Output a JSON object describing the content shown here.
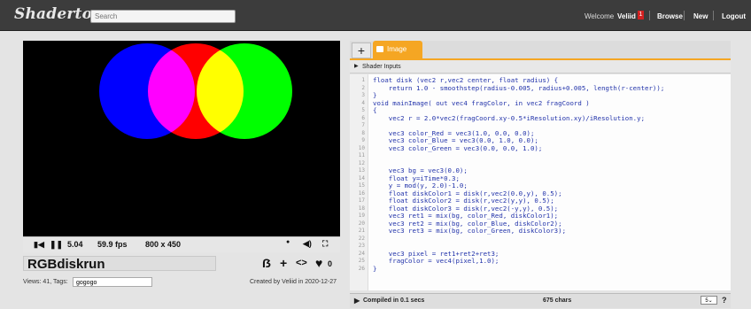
{
  "header": {
    "logo": "Shadertoy",
    "search_placeholder": "Search",
    "welcome": "Welcome",
    "user": "Veliid",
    "notification_count": "1",
    "browse": "Browse",
    "new": "New",
    "logout": "Logout"
  },
  "player": {
    "time": "5.04",
    "fps": "59.9 fps",
    "resolution": "800 x 450",
    "colors": {
      "red": "#ff0000",
      "green": "#00ff00",
      "blue": "#0000ff"
    }
  },
  "shader": {
    "title": "RGBdiskrun",
    "like_count": "0",
    "views_tags": "Views: 41, Tags:",
    "tag_value": "gogogo",
    "created": "Created by Veliid in 2020-12-27"
  },
  "editor": {
    "tab_add": "+",
    "tab_image": "Image",
    "shader_inputs": "Shader Inputs",
    "lines": [
      {
        "n": "1",
        "t": "float disk (vec2 r,vec2 center, float radius) {"
      },
      {
        "n": "2",
        "t": "    return 1.0 - smoothstep(radius-0.005, radius+0.005, length(r-center));"
      },
      {
        "n": "3",
        "t": "}"
      },
      {
        "n": "4",
        "t": "void mainImage( out vec4 fragColor, in vec2 fragCoord )"
      },
      {
        "n": "5",
        "t": "{"
      },
      {
        "n": "6",
        "t": "    vec2 r = 2.0*vec2(fragCoord.xy-0.5*iResolution.xy)/iResolution.y;"
      },
      {
        "n": "7",
        "t": ""
      },
      {
        "n": "8",
        "t": "    vec3 color_Red = vec3(1.0, 0.0, 0.0);"
      },
      {
        "n": "9",
        "t": "    vec3 color_Blue = vec3(0.0, 1.0, 0.0);"
      },
      {
        "n": "10",
        "t": "    vec3 color_Green = vec3(0.0, 0.0, 1.0);"
      },
      {
        "n": "11",
        "t": ""
      },
      {
        "n": "12",
        "t": ""
      },
      {
        "n": "13",
        "t": "    vec3 bg = vec3(0.0);"
      },
      {
        "n": "14",
        "t": "    float y=iTime*0.3;"
      },
      {
        "n": "15",
        "t": "    y = mod(y, 2.0)-1.0;"
      },
      {
        "n": "16",
        "t": "    float diskColor1 = disk(r,vec2(0.0,y), 0.5);"
      },
      {
        "n": "17",
        "t": "    float diskColor2 = disk(r,vec2(y,y), 0.5);"
      },
      {
        "n": "18",
        "t": "    float diskColor3 = disk(r,vec2(-y,y), 0.5);"
      },
      {
        "n": "19",
        "t": "    vec3 ret1 = mix(bg, color_Red, diskColor1);"
      },
      {
        "n": "20",
        "t": "    vec3 ret2 = mix(bg, color_Blue, diskColor2);"
      },
      {
        "n": "21",
        "t": "    vec3 ret3 = mix(bg, color_Green, diskColor3);"
      },
      {
        "n": "22",
        "t": ""
      },
      {
        "n": "23",
        "t": ""
      },
      {
        "n": "24",
        "t": "    vec3 pixel = ret1+ret2+ret3;"
      },
      {
        "n": "25",
        "t": "    fragColor = vec4(pixel,1.0);"
      },
      {
        "n": "26",
        "t": "}"
      }
    ],
    "compiled": "Compiled in 0.1 secs",
    "chars": "675 chars",
    "font_size_select": "5",
    "help": "?"
  },
  "colors": {
    "accent": "#f5a623",
    "header_bg": "#3c3c3c"
  }
}
